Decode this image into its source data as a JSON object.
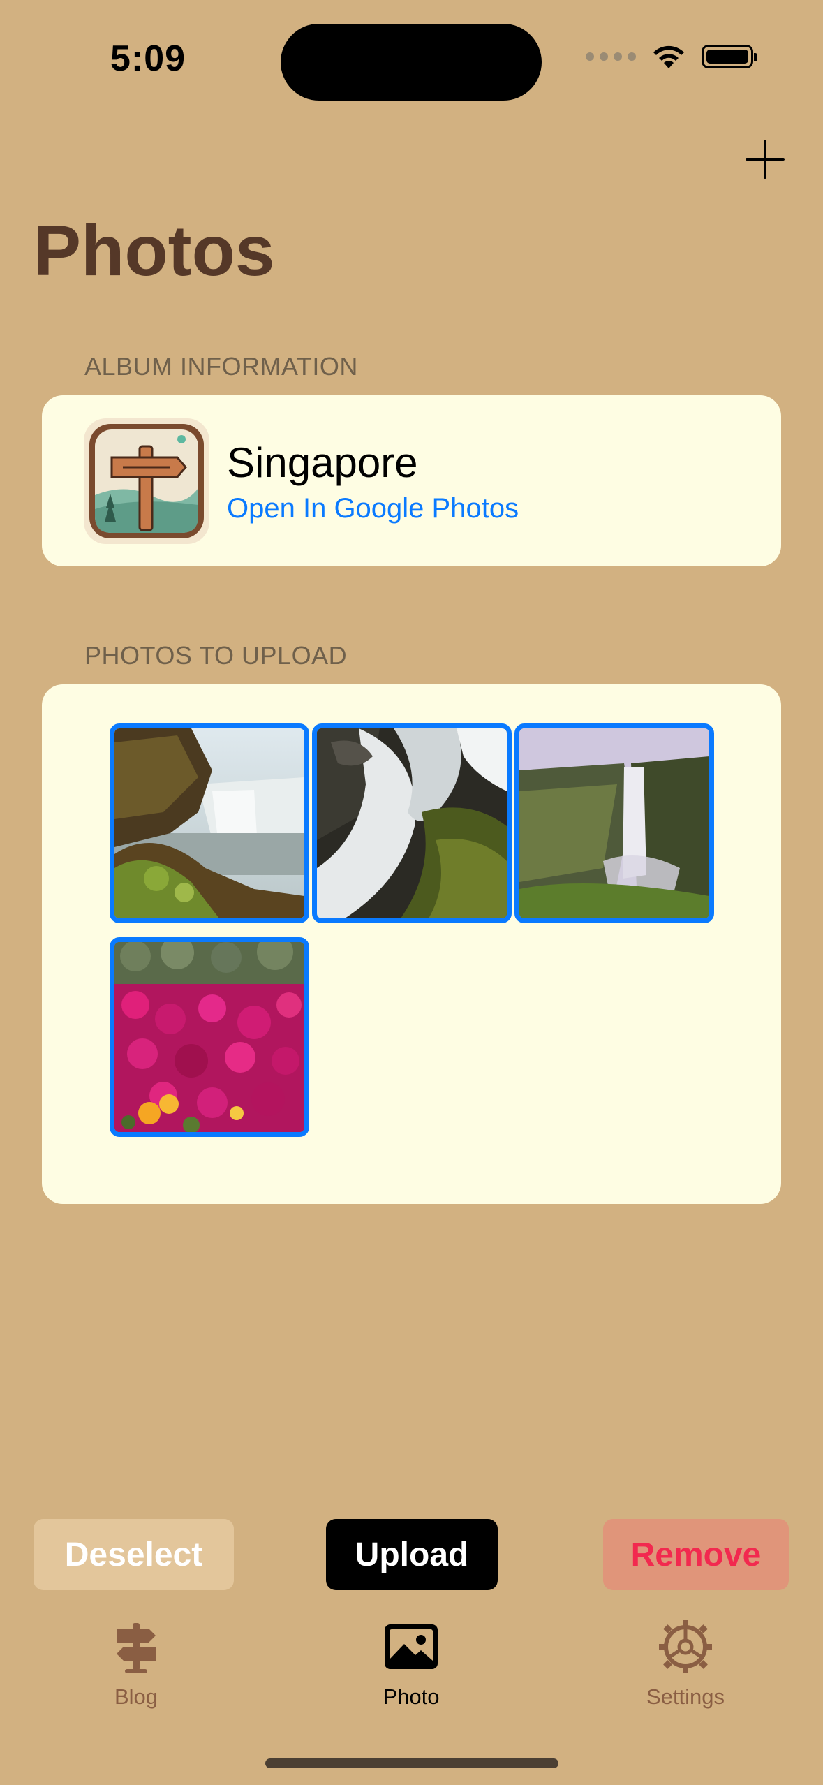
{
  "status_bar": {
    "time": "5:09"
  },
  "header": {
    "title": "Photos",
    "add_icon": "plus-icon"
  },
  "album_section": {
    "header": "ALBUM INFORMATION",
    "album_name": "Singapore",
    "link_label": "Open In Google Photos",
    "icon": "signpost-app-icon"
  },
  "photos_section": {
    "header": "PHOTOS TO UPLOAD",
    "photos": [
      {
        "subject": "waterfall-cliff",
        "selected": true
      },
      {
        "subject": "waterfall-rocks",
        "selected": true
      },
      {
        "subject": "waterfall-valley",
        "selected": true
      },
      {
        "subject": "pink-flowers",
        "selected": true
      }
    ]
  },
  "actions": {
    "deselect_label": "Deselect",
    "upload_label": "Upload",
    "remove_label": "Remove"
  },
  "tabs": [
    {
      "label": "Blog",
      "icon": "signpost-icon",
      "active": false
    },
    {
      "label": "Photo",
      "icon": "photo-icon",
      "active": true
    },
    {
      "label": "Settings",
      "icon": "gear-icon",
      "active": false
    }
  ],
  "colors": {
    "background": "#D2B181",
    "card": "#FEFDE3",
    "accent": "#0A7AFF",
    "title": "#553828",
    "remove_text": "#F2294F"
  }
}
